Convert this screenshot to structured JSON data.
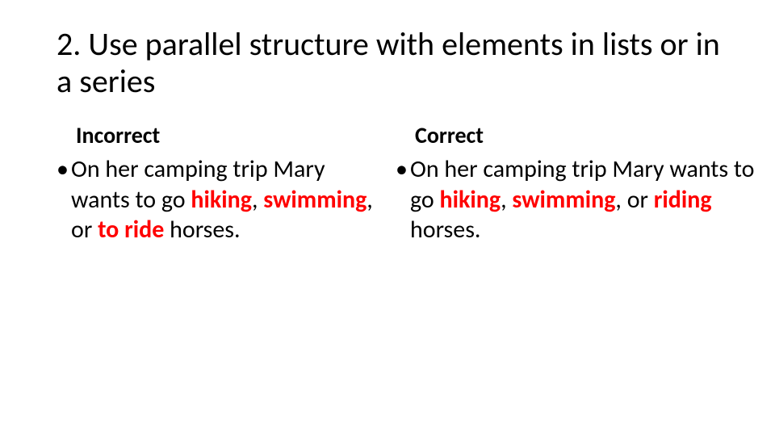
{
  "title": "2. Use parallel structure with elements in lists or in a series",
  "left": {
    "heading": "Incorrect",
    "bullet": "•",
    "t1": "On her camping trip Mary wants to go ",
    "hiking": "hiking",
    "comma1": ", ",
    "swimming": "swimming",
    "comma_or": ", or ",
    "to": "to ",
    "ride": "ride",
    "t_end": " horses."
  },
  "right": {
    "heading": "Correct",
    "bullet": "•",
    "t1": "On her camping trip Mary wants to go ",
    "hiking": "hiking",
    "comma1": ", ",
    "swimming": "swimming",
    "comma2": ", ",
    "or": "or ",
    "riding": "riding",
    "t_end": " horses."
  }
}
